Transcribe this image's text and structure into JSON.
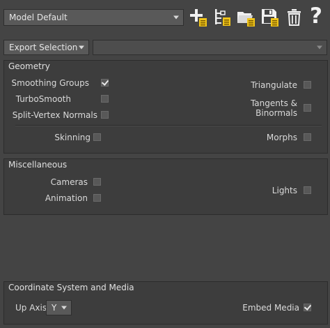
{
  "preset": {
    "selected": "Model Default"
  },
  "toolbar": {
    "icons": [
      "add-preset-icon",
      "edit-preset-icon",
      "open-folder-icon",
      "save-icon",
      "delete-icon",
      "help-icon"
    ],
    "help_glyph": "?"
  },
  "export": {
    "selected": "Export Selection",
    "secondary": ""
  },
  "geometry": {
    "title": "Geometry",
    "smoothing_groups": {
      "label": "Smoothing Groups",
      "checked": true
    },
    "turbosmooth": {
      "label": "TurboSmooth",
      "checked": false
    },
    "split_vertex_normals": {
      "label": "Split-Vertex Normals",
      "checked": false
    },
    "triangulate": {
      "label": "Triangulate",
      "checked": false
    },
    "tangents_line1": "Tangents &",
    "tangents_line2": "Binormals",
    "tangents_checked": false,
    "skinning": {
      "label": "Skinning",
      "checked": false
    },
    "morphs": {
      "label": "Morphs",
      "checked": false
    }
  },
  "misc": {
    "title": "Miscellaneous",
    "cameras": {
      "label": "Cameras",
      "checked": false
    },
    "animation": {
      "label": "Animation",
      "checked": false
    },
    "lights": {
      "label": "Lights",
      "checked": false
    }
  },
  "coord": {
    "title": "Coordinate System and Media",
    "up_axis_label": "Up Axis",
    "up_axis_value": "Y",
    "embed_media": {
      "label": "Embed Media",
      "checked": true
    }
  },
  "colors": {
    "background": "#444444",
    "panel": "#3d3d3d",
    "accent_yellow": "#f0c419"
  }
}
